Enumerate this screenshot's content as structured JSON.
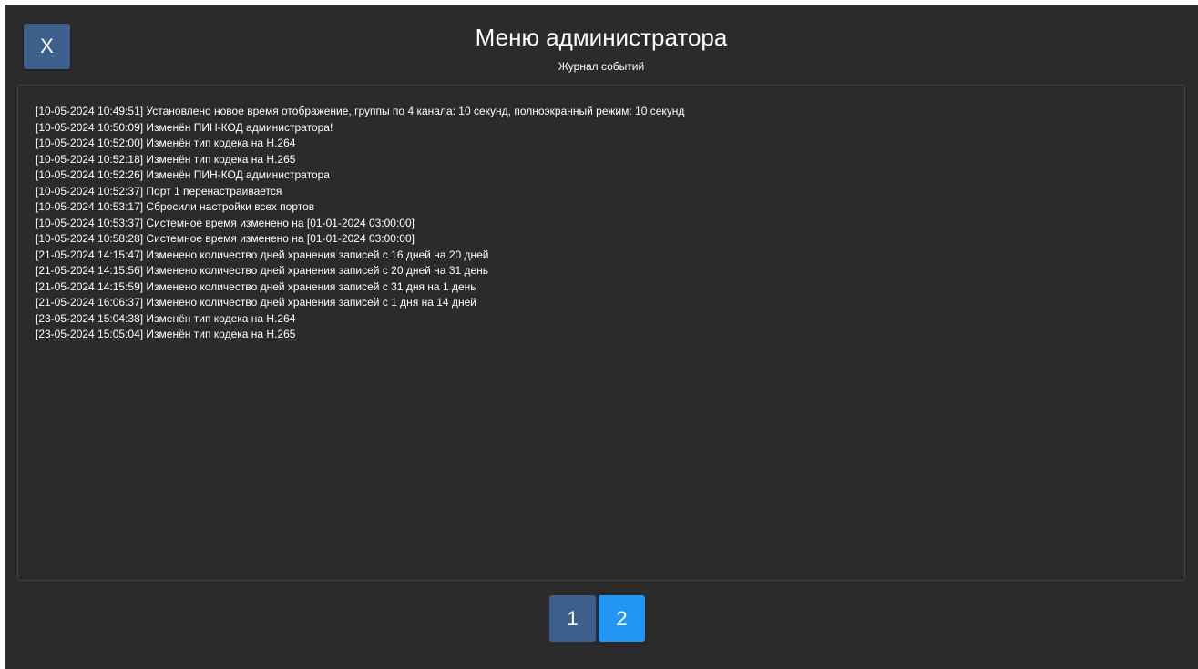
{
  "header": {
    "close_label": "X",
    "title": "Меню администратора",
    "subtitle": "Журнал событий"
  },
  "log": {
    "entries": [
      "[10-05-2024 10:49:51] Установлено новое время отображение, группы по 4 канала: 10 секунд, полноэкранный режим: 10 секунд",
      "[10-05-2024 10:50:09] Изменён ПИН-КОД администратора!",
      "[10-05-2024 10:52:00] Изменён тип кодека на H.264",
      "[10-05-2024 10:52:18] Изменён тип кодека на H.265",
      "[10-05-2024 10:52:26] Изменён ПИН-КОД администратора",
      "[10-05-2024 10:52:37] Порт 1 перенастраивается",
      "[10-05-2024 10:53:17] Сбросили настройки всех портов",
      "[10-05-2024 10:53:37] Системное время изменено на [01-01-2024 03:00:00]",
      "[10-05-2024 10:58:28] Системное время изменено на [01-01-2024 03:00:00]",
      "[21-05-2024 14:15:47] Изменено количество дней хранения записей с 16 дней на 20 дней",
      "[21-05-2024 14:15:56] Изменено количество дней хранения записей с 20 дней на 31 день",
      "[21-05-2024 14:15:59] Изменено количество дней хранения записей с 31 дня на 1 день",
      "[21-05-2024 16:06:37] Изменено количество дней хранения записей с 1 дня на 14 дней",
      "[23-05-2024 15:04:38] Изменён тип кодека на H.264",
      "[23-05-2024 15:05:04] Изменён тип кодека на H.265"
    ]
  },
  "pagination": {
    "pages": [
      "1",
      "2"
    ],
    "current": "2"
  },
  "colors": {
    "background": "#2b2b2b",
    "button": "#3c5f8c",
    "active_page": "#2196f3",
    "text": "#ffffff"
  }
}
